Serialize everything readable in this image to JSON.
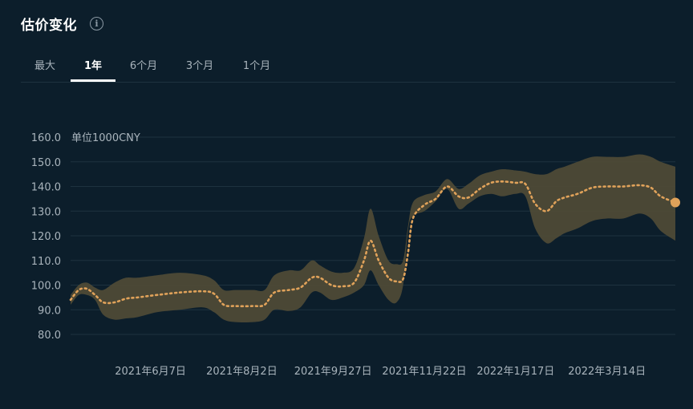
{
  "header": {
    "title": "估价变化",
    "info_icon": "info-icon"
  },
  "tabs": [
    {
      "label": "最大",
      "active": false
    },
    {
      "label": "1年",
      "active": true
    },
    {
      "label": "6个月",
      "active": false
    },
    {
      "label": "3个月",
      "active": false
    },
    {
      "label": "1个月",
      "active": false
    }
  ],
  "colors": {
    "background": "#0c1e2b",
    "band": "#4e4a36",
    "line": "#e0a25a",
    "grid": "#1e323f"
  },
  "chart_data": {
    "type": "area",
    "unit_label": "单位1000CNY",
    "ylim": [
      80,
      160
    ],
    "y_ticks": [
      "160.0",
      "150.0",
      "140.0",
      "130.0",
      "120.0",
      "110.0",
      "100.0",
      "90.0",
      "80.0"
    ],
    "grid": true,
    "x_domain": [
      "2021-04-19",
      "2022-04-25"
    ],
    "x_ticks": [
      {
        "date": "2021-06-07",
        "label": "2021年6月7日"
      },
      {
        "date": "2021-08-02",
        "label": "2021年8月2日"
      },
      {
        "date": "2021-09-27",
        "label": "2021年9月27日"
      },
      {
        "date": "2021-11-22",
        "label": "2021年11月22日"
      },
      {
        "date": "2022-01-17",
        "label": "2022年1月17日"
      },
      {
        "date": "2022-03-14",
        "label": "2022年3月14日"
      }
    ],
    "series": [
      {
        "dates": [
          "2021-04-19",
          "2021-04-24",
          "2021-04-29",
          "2021-05-04",
          "2021-05-09",
          "2021-05-16",
          "2021-05-23",
          "2021-05-30",
          "2021-06-11",
          "2021-06-25",
          "2021-07-09",
          "2021-07-16",
          "2021-07-22",
          "2021-07-29",
          "2021-08-09",
          "2021-08-16",
          "2021-08-22",
          "2021-08-31",
          "2021-09-07",
          "2021-09-14",
          "2021-09-19",
          "2021-09-26",
          "2021-10-03",
          "2021-10-10",
          "2021-10-16",
          "2021-10-20",
          "2021-10-25",
          "2021-10-31",
          "2021-11-05",
          "2021-11-09",
          "2021-11-12",
          "2021-11-15",
          "2021-11-22",
          "2021-11-29",
          "2021-12-06",
          "2021-12-13",
          "2021-12-19",
          "2021-12-26",
          "2022-01-02",
          "2022-01-09",
          "2022-01-17",
          "2022-01-23",
          "2022-01-29",
          "2022-02-05",
          "2022-02-11",
          "2022-02-16",
          "2022-02-24",
          "2022-03-05",
          "2022-03-14",
          "2022-03-24",
          "2022-04-03",
          "2022-04-10",
          "2022-04-16",
          "2022-04-25"
        ],
        "values": [
          94,
          98,
          98.5,
          96,
          93,
          93,
          94.5,
          95,
          96,
          97,
          97.5,
          96.5,
          92,
          91.5,
          91.5,
          92,
          97,
          98,
          99,
          103,
          103,
          100,
          99.5,
          101,
          110,
          118,
          110,
          103,
          101.5,
          102.5,
          113,
          127,
          132.5,
          135,
          140,
          136,
          135.5,
          139,
          141.5,
          142,
          141.5,
          141,
          133,
          130,
          134,
          135.5,
          137,
          139.5,
          140,
          140,
          140.5,
          139.5,
          136,
          133.5
        ],
        "lower": [
          92,
          96,
          96,
          94,
          88,
          86,
          86.5,
          87,
          89,
          90,
          91,
          89,
          86,
          85,
          85,
          86,
          90,
          89.5,
          91,
          97,
          97,
          94,
          95,
          97,
          100,
          106,
          100,
          94,
          93,
          100,
          122,
          128,
          130,
          134,
          139,
          131,
          133,
          136,
          137,
          136,
          137,
          136,
          123,
          117,
          119,
          121,
          123,
          126,
          127,
          127,
          129,
          127,
          122,
          118
        ],
        "upper": [
          96,
          100,
          101,
          99,
          98,
          101,
          103,
          103,
          104,
          105,
          104,
          102,
          98,
          98,
          98,
          98,
          104,
          106,
          106,
          110,
          108,
          105.5,
          105,
          107,
          119,
          131,
          120,
          110,
          108.5,
          110,
          124,
          133.5,
          136.5,
          138,
          143,
          139,
          141,
          144.5,
          146,
          147,
          146.5,
          146,
          145,
          145,
          147,
          148,
          150,
          152,
          152,
          152,
          153,
          152,
          150,
          148
        ]
      }
    ]
  }
}
